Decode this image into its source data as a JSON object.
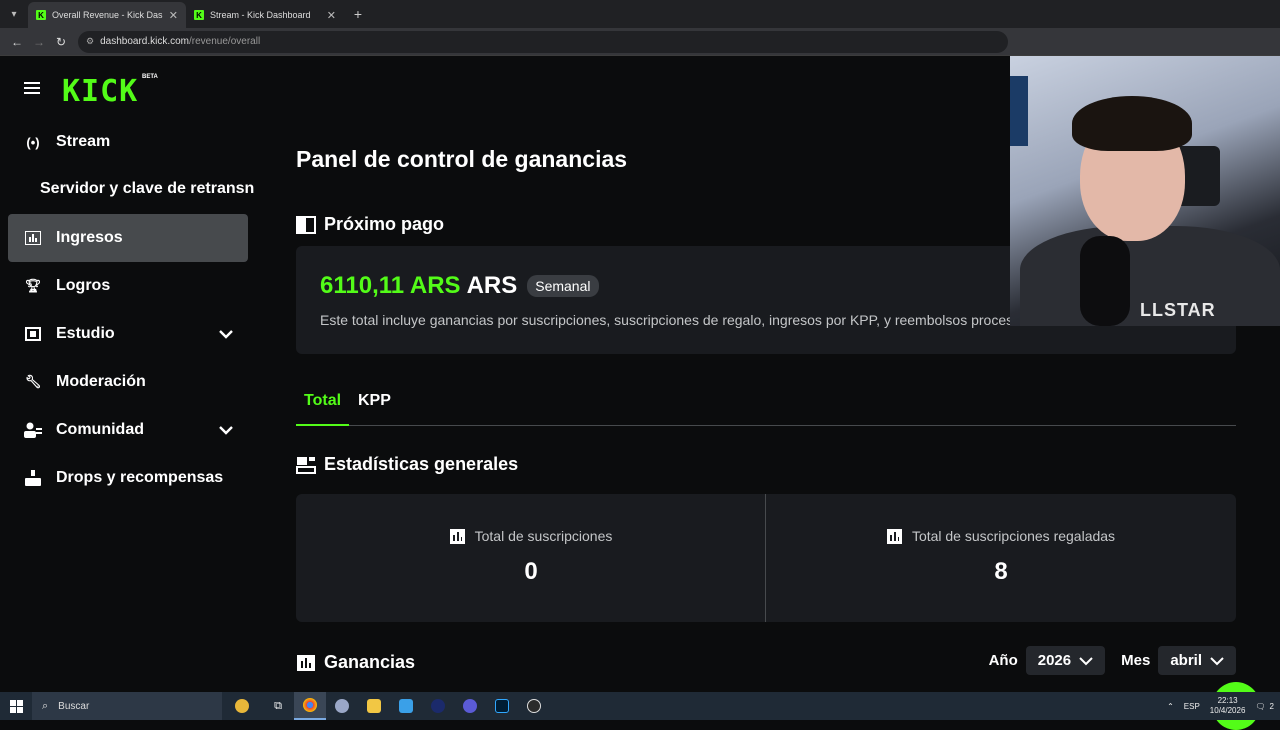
{
  "browser": {
    "tabs": [
      {
        "title": "Overall Revenue - Kick Dashboard",
        "active": true
      },
      {
        "title": "Stream - Kick Dashboard",
        "active": false
      }
    ],
    "url_host": "dashboard.kick.com",
    "url_path": "/revenue/overall"
  },
  "sidebar": {
    "logo": "KICK",
    "beta": "BETA",
    "items": [
      {
        "label": "Stream",
        "icon": "broadcast-icon"
      },
      {
        "label": "Servidor y clave de retransn",
        "sub": true
      },
      {
        "label": "Ingresos",
        "icon": "chart-icon",
        "active": true
      },
      {
        "label": "Logros",
        "icon": "trophy-icon"
      },
      {
        "label": "Estudio",
        "icon": "studio-icon",
        "expandable": true
      },
      {
        "label": "Moderación",
        "icon": "wrench-icon"
      },
      {
        "label": "Comunidad",
        "icon": "community-icon",
        "expandable": true
      },
      {
        "label": "Drops y recompensas",
        "icon": "drops-icon"
      }
    ]
  },
  "main": {
    "title": "Panel de control de ganancias",
    "next_payment": {
      "heading": "Próximo pago",
      "amount": "6110,11 ARS",
      "currency": "ARS",
      "period": "Semanal",
      "description": "Este total incluye ganancias por suscripciones, suscripciones de regalo, ingresos por KPP, y reembolsos procesados."
    },
    "tabs": [
      "Total",
      "KPP"
    ],
    "stats": {
      "heading": "Estadísticas generales",
      "items": [
        {
          "label": "Total de suscripciones",
          "value": "0"
        },
        {
          "label": "Total de suscripciones regaladas",
          "value": "8"
        }
      ]
    },
    "earnings": {
      "heading": "Ganancias",
      "year_label": "Año",
      "year": "2026",
      "month_label": "Mes",
      "month": "abril"
    }
  },
  "webcam": {
    "shirt_text": "LLSTAR"
  },
  "taskbar": {
    "search": "Buscar",
    "lang": "ESP",
    "time": "22:13",
    "date": "10/4/2026",
    "notifications": "2"
  },
  "colors": {
    "accent": "#53fc18",
    "bg": "#0b0c0d",
    "card": "#191b1f",
    "active_nav": "#474a4d"
  }
}
